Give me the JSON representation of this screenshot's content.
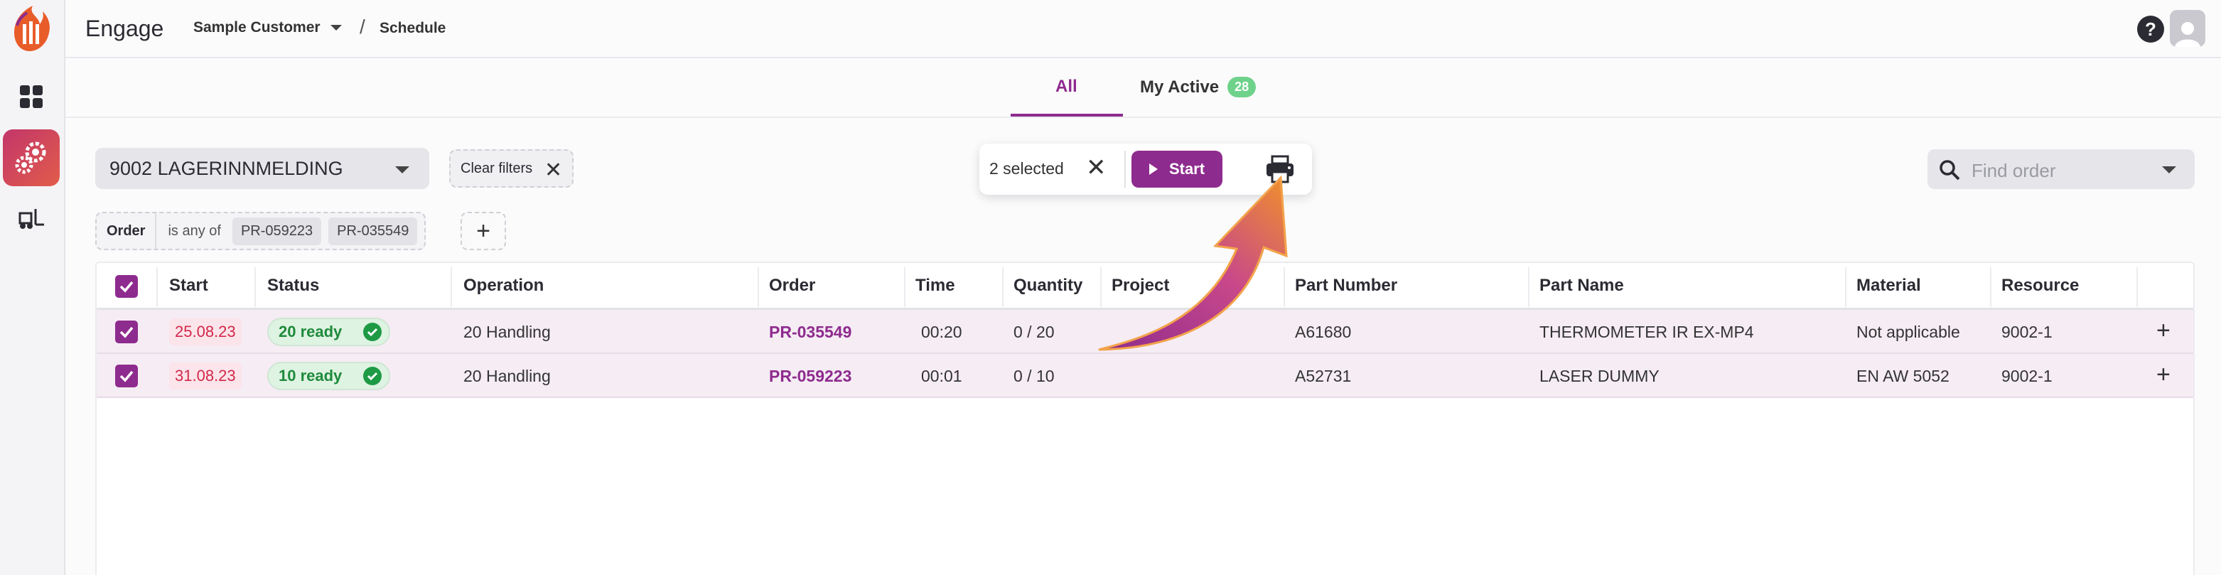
{
  "app": {
    "title": "Engage"
  },
  "header": {
    "customer": "Sample Customer",
    "separator": "/",
    "page": "Schedule"
  },
  "tabs": [
    {
      "label": "All",
      "active": true
    },
    {
      "label": "My Active",
      "badge": "28"
    }
  ],
  "filters": {
    "operation_select": "9002 LAGERINNMELDING",
    "clear_label": "Clear filters",
    "chip": {
      "field": "Order",
      "operator": "is any of",
      "values": [
        "PR-059223",
        "PR-035549"
      ]
    }
  },
  "selection": {
    "text": "2 selected",
    "start_label": "Start"
  },
  "search": {
    "placeholder": "Find order"
  },
  "table": {
    "columns": [
      "Start",
      "Status",
      "Operation",
      "Order",
      "Time",
      "Quantity",
      "Project",
      "Part Number",
      "Part Name",
      "Material",
      "Resource"
    ],
    "rows": [
      {
        "start": "25.08.23",
        "status": "20 ready",
        "operation": "20 Handling",
        "order": "PR-035549",
        "time": "00:20",
        "quantity": "0 / 20",
        "project": "",
        "part_number": "A61680",
        "part_name": "THERMOMETER IR EX-MP4",
        "material": "Not applicable",
        "resource": "9002-1"
      },
      {
        "start": "31.08.23",
        "status": "10 ready",
        "operation": "20 Handling",
        "order": "PR-059223",
        "time": "00:01",
        "quantity": "0 / 10",
        "project": "",
        "part_number": "A52731",
        "part_name": "LASER DUMMY",
        "material": "EN AW 5052",
        "resource": "9002-1"
      }
    ]
  },
  "colors": {
    "accent": "#8e2b8e",
    "ready": "#1e9a45",
    "late": "#d3284a",
    "badge": "#6fd28b"
  }
}
